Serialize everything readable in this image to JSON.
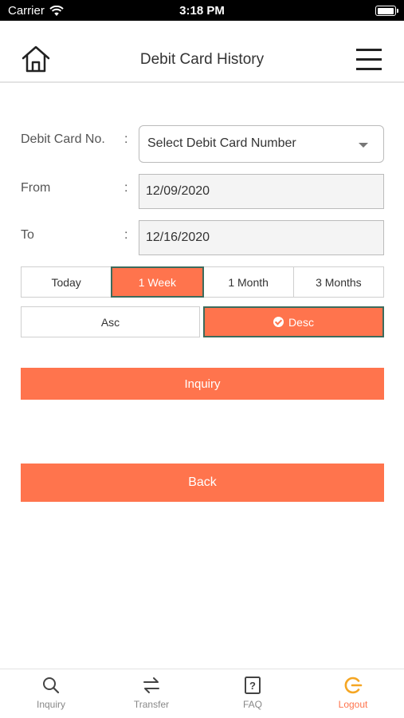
{
  "status_bar": {
    "carrier": "Carrier",
    "time": "3:18 PM"
  },
  "header": {
    "title": "Debit Card History"
  },
  "form": {
    "card_label": "Debit Card No.",
    "card_select": "Select Debit Card Number",
    "from_label": "From",
    "from_value": "12/09/2020",
    "to_label": "To",
    "to_value": "12/16/2020",
    "colon": ":"
  },
  "periods": [
    {
      "label": "Today"
    },
    {
      "label": "1 Week"
    },
    {
      "label": "1 Month"
    },
    {
      "label": "3 Months"
    }
  ],
  "selected_period": "1 Week",
  "order": {
    "asc_label": "Asc",
    "desc_label": "Desc",
    "selected": "Desc"
  },
  "buttons": {
    "inquiry": "Inquiry",
    "back": "Back"
  },
  "tab_bar": {
    "items": [
      {
        "label": "Inquiry",
        "icon": "search-icon"
      },
      {
        "label": "Transfer",
        "icon": "transfer-icon"
      },
      {
        "label": "FAQ",
        "icon": "faq-icon"
      },
      {
        "label": "Logout",
        "icon": "logout-icon"
      }
    ]
  },
  "colors": {
    "accent": "#ff744d",
    "active_border": "#3d6b5c",
    "logout_icon": "#f5a623"
  }
}
